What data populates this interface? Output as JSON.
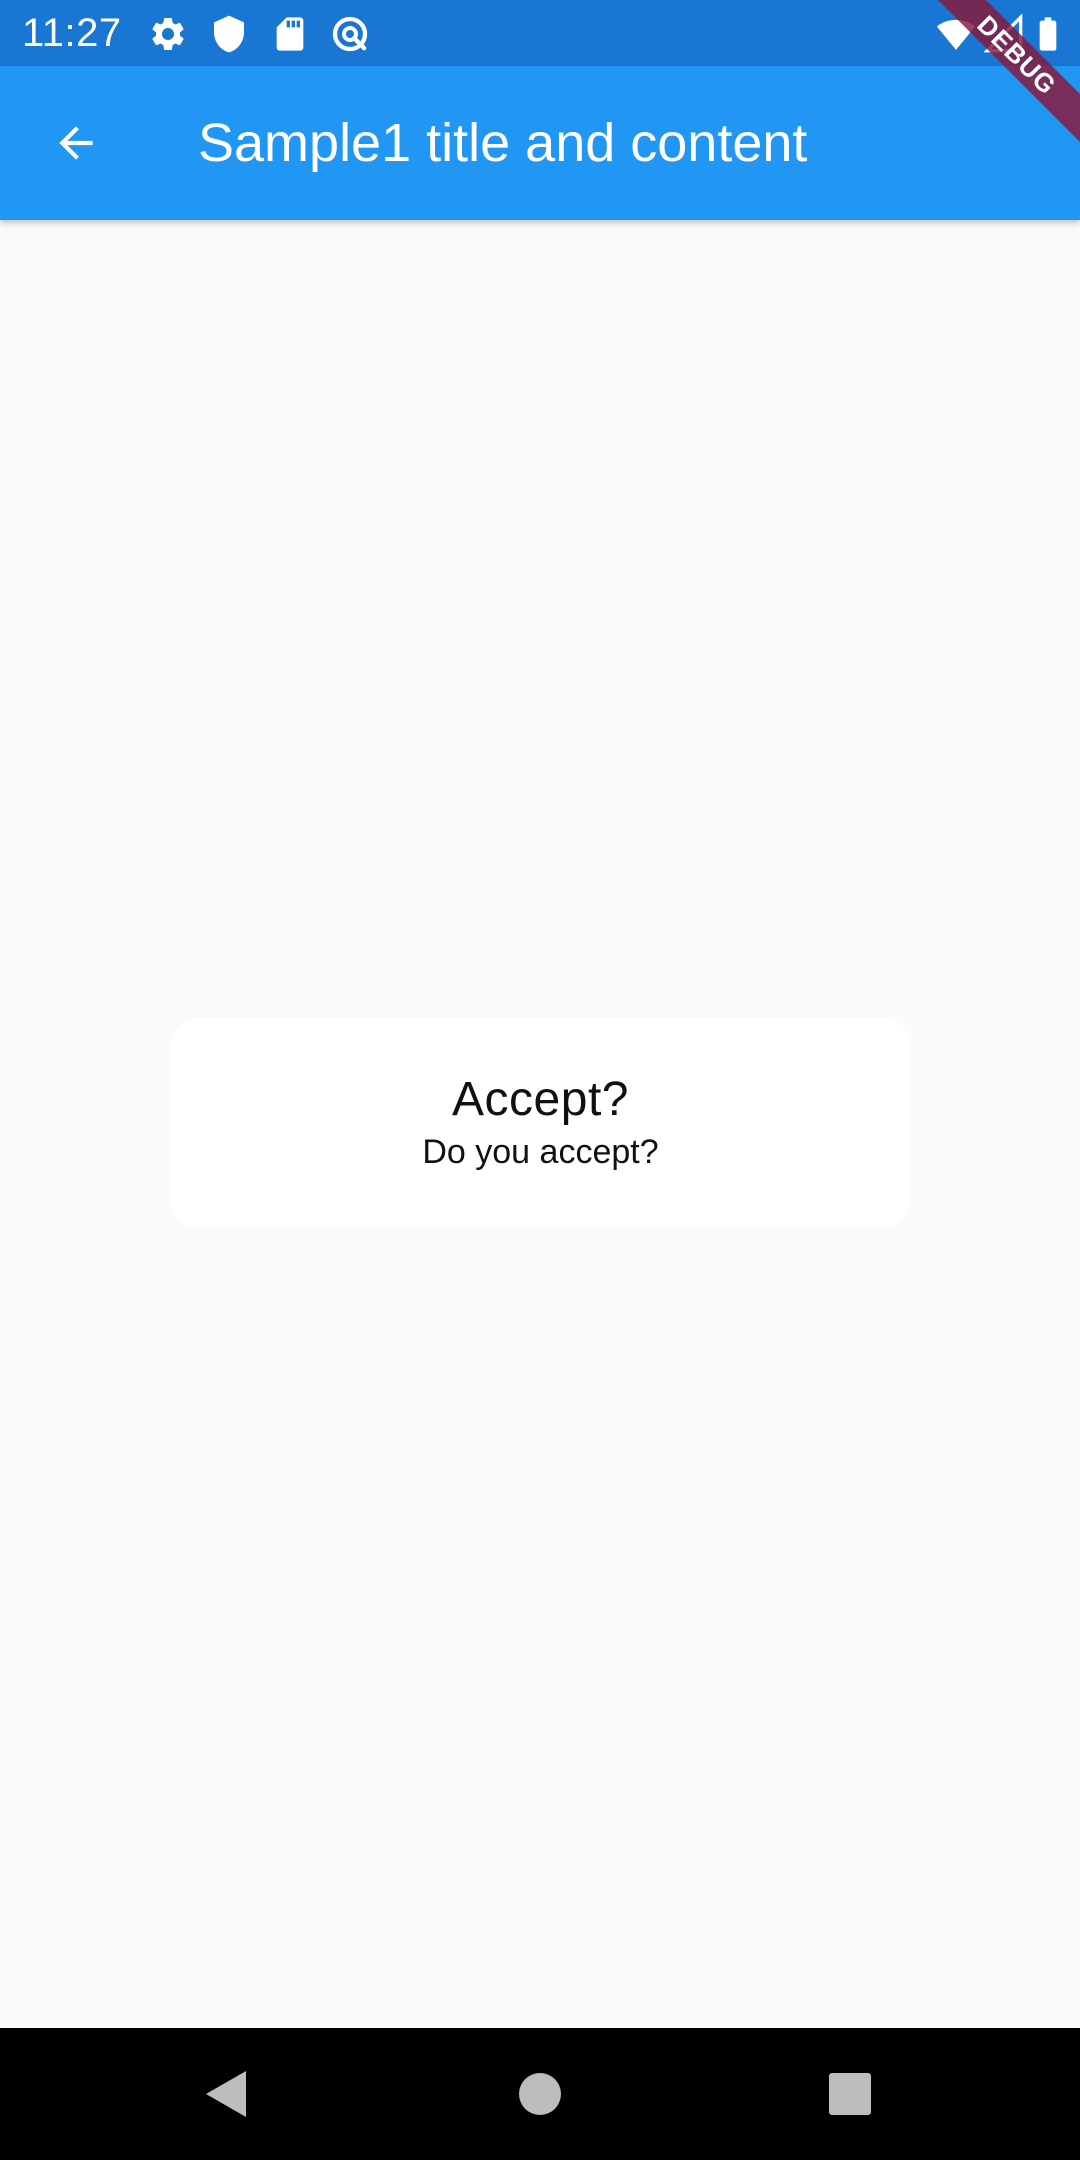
{
  "status_bar": {
    "time": "11:27",
    "left_icons": [
      "gear-icon",
      "shield-icon",
      "sd-card-icon",
      "data-saver-icon"
    ],
    "right_icons": [
      "wifi-icon",
      "cell-signal-icon",
      "battery-icon"
    ],
    "background": "#1976d2"
  },
  "app_bar": {
    "title": "Sample1 title and content",
    "back_icon": "arrow-back-icon",
    "background": "#2196f3"
  },
  "debug_banner": {
    "label": "DEBUG",
    "color": "#881838"
  },
  "dialog": {
    "title": "Accept?",
    "content": "Do you accept?"
  },
  "nav_bar": {
    "buttons": [
      "back-triangle-icon",
      "home-circle-icon",
      "recents-square-icon"
    ],
    "background": "#000000"
  }
}
